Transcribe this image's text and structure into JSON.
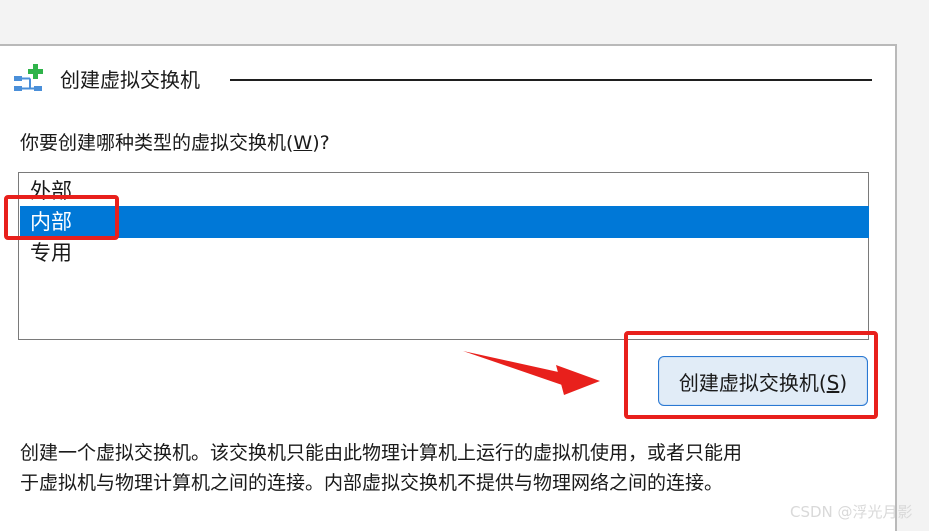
{
  "header": {
    "title": "创建虚拟交换机",
    "icon": "network-switch-add-icon"
  },
  "question": {
    "prefix": "你要创建哪种类型的虚拟交换机(",
    "key": "W",
    "suffix": ")?"
  },
  "switch_types": {
    "items": [
      {
        "label": "外部",
        "selected": false
      },
      {
        "label": "内部",
        "selected": true
      },
      {
        "label": "专用",
        "selected": false
      }
    ]
  },
  "create_button": {
    "prefix": "创建虚拟交换机(",
    "key": "S",
    "suffix": ")"
  },
  "description": {
    "line1": "创建一个虚拟交换机。该交换机只能由此物理计算机上运行的虚拟机使用，或者只能用",
    "line2": "于虚拟机与物理计算机之间的连接。内部虚拟交换机不提供与物理网络之间的连接。"
  },
  "watermark": "CSDN @浮光月影",
  "colors": {
    "selection": "#0078d7",
    "annotation_red": "#e8201c",
    "button_border": "#2a78d2"
  }
}
